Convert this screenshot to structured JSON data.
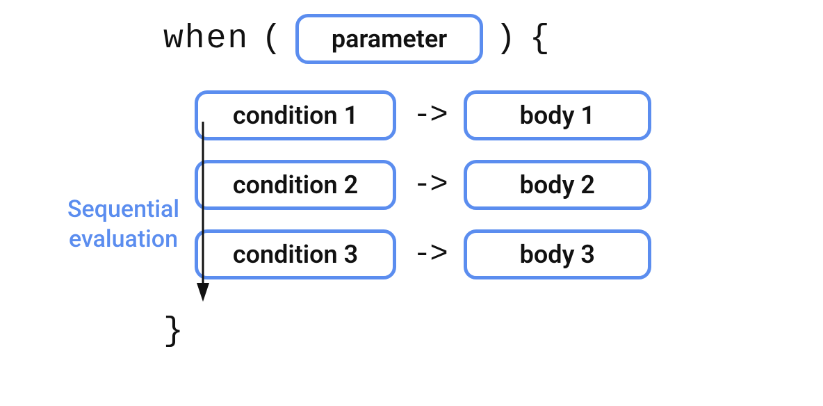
{
  "header": {
    "keyword": "when",
    "open_paren": "(",
    "parameter": "parameter",
    "close_paren": ")",
    "open_brace": "{"
  },
  "branches": [
    {
      "condition": "condition 1",
      "arrow": "->",
      "body": "body 1"
    },
    {
      "condition": "condition 2",
      "arrow": "->",
      "body": "body 2"
    },
    {
      "condition": "condition 3",
      "arrow": "->",
      "body": "body 3"
    }
  ],
  "close_brace": "}",
  "annotation": {
    "line1": "Sequential",
    "line2": "evaluation"
  }
}
